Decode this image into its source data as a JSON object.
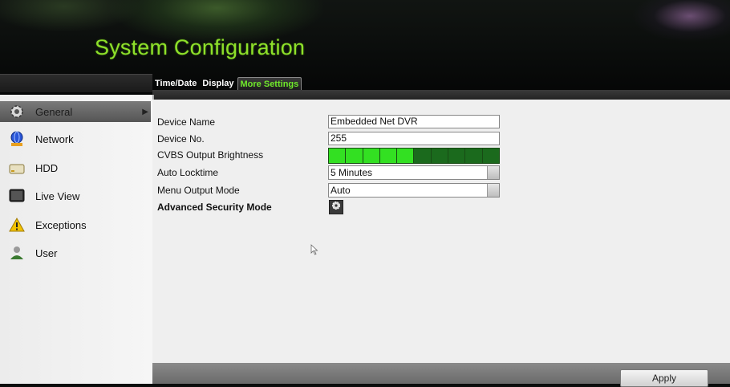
{
  "header": {
    "title": "System Configuration"
  },
  "tabs": [
    {
      "label": "Time/Date",
      "active": false
    },
    {
      "label": "Display",
      "active": false
    },
    {
      "label": "More Settings",
      "active": true
    }
  ],
  "sidebar": {
    "items": [
      {
        "label": "General",
        "icon": "gear-icon",
        "active": true
      },
      {
        "label": "Network",
        "icon": "network-globe-icon",
        "active": false
      },
      {
        "label": "HDD",
        "icon": "hdd-icon",
        "active": false
      },
      {
        "label": "Live View",
        "icon": "monitor-icon",
        "active": false
      },
      {
        "label": "Exceptions",
        "icon": "warning-icon",
        "active": false
      },
      {
        "label": "User",
        "icon": "user-icon",
        "active": false
      }
    ]
  },
  "form": {
    "device_name": {
      "label": "Device Name",
      "value": "Embedded Net DVR"
    },
    "device_no": {
      "label": "Device No.",
      "value": "255"
    },
    "cvbs_brightness": {
      "label": "CVBS Output Brightness",
      "level": 5,
      "max": 10
    },
    "auto_locktime": {
      "label": "Auto Locktime",
      "value": "5 Minutes"
    },
    "menu_output_mode": {
      "label": "Menu Output Mode",
      "value": "Auto"
    },
    "advanced_security_mode": {
      "label": "Advanced Security Mode",
      "icon": "settings-gear-icon"
    }
  },
  "footer": {
    "apply_label": "Apply"
  },
  "colors": {
    "title": "#8ee02a",
    "active_tab_text": "#6fe82a",
    "brightness_on": "#33e022",
    "brightness_off": "#1b6a1d"
  }
}
